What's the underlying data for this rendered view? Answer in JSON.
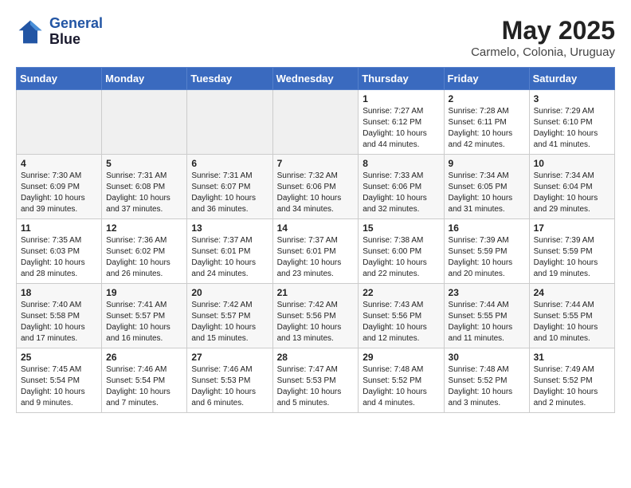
{
  "header": {
    "logo_line1": "General",
    "logo_line2": "Blue",
    "month_year": "May 2025",
    "location": "Carmelo, Colonia, Uruguay"
  },
  "weekdays": [
    "Sunday",
    "Monday",
    "Tuesday",
    "Wednesday",
    "Thursday",
    "Friday",
    "Saturday"
  ],
  "weeks": [
    [
      {
        "day": "",
        "info": ""
      },
      {
        "day": "",
        "info": ""
      },
      {
        "day": "",
        "info": ""
      },
      {
        "day": "",
        "info": ""
      },
      {
        "day": "1",
        "info": "Sunrise: 7:27 AM\nSunset: 6:12 PM\nDaylight: 10 hours\nand 44 minutes."
      },
      {
        "day": "2",
        "info": "Sunrise: 7:28 AM\nSunset: 6:11 PM\nDaylight: 10 hours\nand 42 minutes."
      },
      {
        "day": "3",
        "info": "Sunrise: 7:29 AM\nSunset: 6:10 PM\nDaylight: 10 hours\nand 41 minutes."
      }
    ],
    [
      {
        "day": "4",
        "info": "Sunrise: 7:30 AM\nSunset: 6:09 PM\nDaylight: 10 hours\nand 39 minutes."
      },
      {
        "day": "5",
        "info": "Sunrise: 7:31 AM\nSunset: 6:08 PM\nDaylight: 10 hours\nand 37 minutes."
      },
      {
        "day": "6",
        "info": "Sunrise: 7:31 AM\nSunset: 6:07 PM\nDaylight: 10 hours\nand 36 minutes."
      },
      {
        "day": "7",
        "info": "Sunrise: 7:32 AM\nSunset: 6:06 PM\nDaylight: 10 hours\nand 34 minutes."
      },
      {
        "day": "8",
        "info": "Sunrise: 7:33 AM\nSunset: 6:06 PM\nDaylight: 10 hours\nand 32 minutes."
      },
      {
        "day": "9",
        "info": "Sunrise: 7:34 AM\nSunset: 6:05 PM\nDaylight: 10 hours\nand 31 minutes."
      },
      {
        "day": "10",
        "info": "Sunrise: 7:34 AM\nSunset: 6:04 PM\nDaylight: 10 hours\nand 29 minutes."
      }
    ],
    [
      {
        "day": "11",
        "info": "Sunrise: 7:35 AM\nSunset: 6:03 PM\nDaylight: 10 hours\nand 28 minutes."
      },
      {
        "day": "12",
        "info": "Sunrise: 7:36 AM\nSunset: 6:02 PM\nDaylight: 10 hours\nand 26 minutes."
      },
      {
        "day": "13",
        "info": "Sunrise: 7:37 AM\nSunset: 6:01 PM\nDaylight: 10 hours\nand 24 minutes."
      },
      {
        "day": "14",
        "info": "Sunrise: 7:37 AM\nSunset: 6:01 PM\nDaylight: 10 hours\nand 23 minutes."
      },
      {
        "day": "15",
        "info": "Sunrise: 7:38 AM\nSunset: 6:00 PM\nDaylight: 10 hours\nand 22 minutes."
      },
      {
        "day": "16",
        "info": "Sunrise: 7:39 AM\nSunset: 5:59 PM\nDaylight: 10 hours\nand 20 minutes."
      },
      {
        "day": "17",
        "info": "Sunrise: 7:39 AM\nSunset: 5:59 PM\nDaylight: 10 hours\nand 19 minutes."
      }
    ],
    [
      {
        "day": "18",
        "info": "Sunrise: 7:40 AM\nSunset: 5:58 PM\nDaylight: 10 hours\nand 17 minutes."
      },
      {
        "day": "19",
        "info": "Sunrise: 7:41 AM\nSunset: 5:57 PM\nDaylight: 10 hours\nand 16 minutes."
      },
      {
        "day": "20",
        "info": "Sunrise: 7:42 AM\nSunset: 5:57 PM\nDaylight: 10 hours\nand 15 minutes."
      },
      {
        "day": "21",
        "info": "Sunrise: 7:42 AM\nSunset: 5:56 PM\nDaylight: 10 hours\nand 13 minutes."
      },
      {
        "day": "22",
        "info": "Sunrise: 7:43 AM\nSunset: 5:56 PM\nDaylight: 10 hours\nand 12 minutes."
      },
      {
        "day": "23",
        "info": "Sunrise: 7:44 AM\nSunset: 5:55 PM\nDaylight: 10 hours\nand 11 minutes."
      },
      {
        "day": "24",
        "info": "Sunrise: 7:44 AM\nSunset: 5:55 PM\nDaylight: 10 hours\nand 10 minutes."
      }
    ],
    [
      {
        "day": "25",
        "info": "Sunrise: 7:45 AM\nSunset: 5:54 PM\nDaylight: 10 hours\nand 9 minutes."
      },
      {
        "day": "26",
        "info": "Sunrise: 7:46 AM\nSunset: 5:54 PM\nDaylight: 10 hours\nand 7 minutes."
      },
      {
        "day": "27",
        "info": "Sunrise: 7:46 AM\nSunset: 5:53 PM\nDaylight: 10 hours\nand 6 minutes."
      },
      {
        "day": "28",
        "info": "Sunrise: 7:47 AM\nSunset: 5:53 PM\nDaylight: 10 hours\nand 5 minutes."
      },
      {
        "day": "29",
        "info": "Sunrise: 7:48 AM\nSunset: 5:52 PM\nDaylight: 10 hours\nand 4 minutes."
      },
      {
        "day": "30",
        "info": "Sunrise: 7:48 AM\nSunset: 5:52 PM\nDaylight: 10 hours\nand 3 minutes."
      },
      {
        "day": "31",
        "info": "Sunrise: 7:49 AM\nSunset: 5:52 PM\nDaylight: 10 hours\nand 2 minutes."
      }
    ]
  ]
}
